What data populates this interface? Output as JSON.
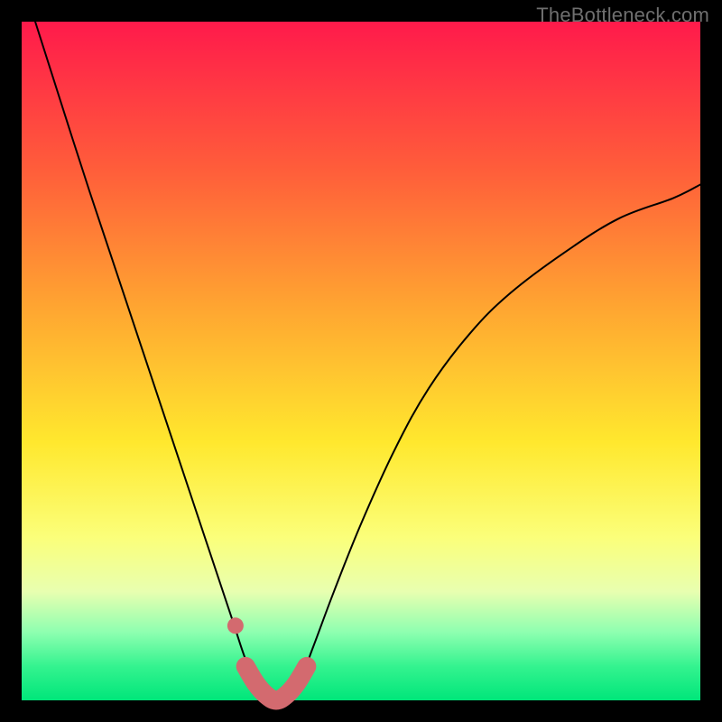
{
  "watermark": "TheBottleneck.com",
  "colors": {
    "accent_pink": "#d36a6f",
    "curve": "#000000"
  },
  "chart_data": {
    "type": "line",
    "title": "",
    "xlabel": "",
    "ylabel": "",
    "xlim": [
      0,
      100
    ],
    "ylim": [
      0,
      100
    ],
    "series": [
      {
        "name": "bottleneck-curve",
        "x": [
          2,
          10,
          18,
          24,
          28,
          31,
          33,
          34.5,
          36,
          37.5,
          39,
          41,
          43,
          46,
          50,
          55,
          60,
          66,
          72,
          80,
          88,
          96,
          100
        ],
        "values": [
          100,
          75,
          51,
          33,
          21,
          12,
          6,
          3,
          1,
          0,
          1,
          3,
          8,
          16,
          26,
          37,
          46,
          54,
          60,
          66,
          71,
          74,
          76
        ]
      }
    ],
    "markers": [
      {
        "name": "highlight-dot",
        "x": 31.5,
        "y": 11
      }
    ],
    "highlight_arc": {
      "name": "bottom-arc",
      "x": [
        33.0,
        34.5,
        36.0,
        37.5,
        39.0,
        40.5,
        42.0
      ],
      "values": [
        5.0,
        2.5,
        0.8,
        0.0,
        0.8,
        2.5,
        5.0
      ]
    }
  }
}
